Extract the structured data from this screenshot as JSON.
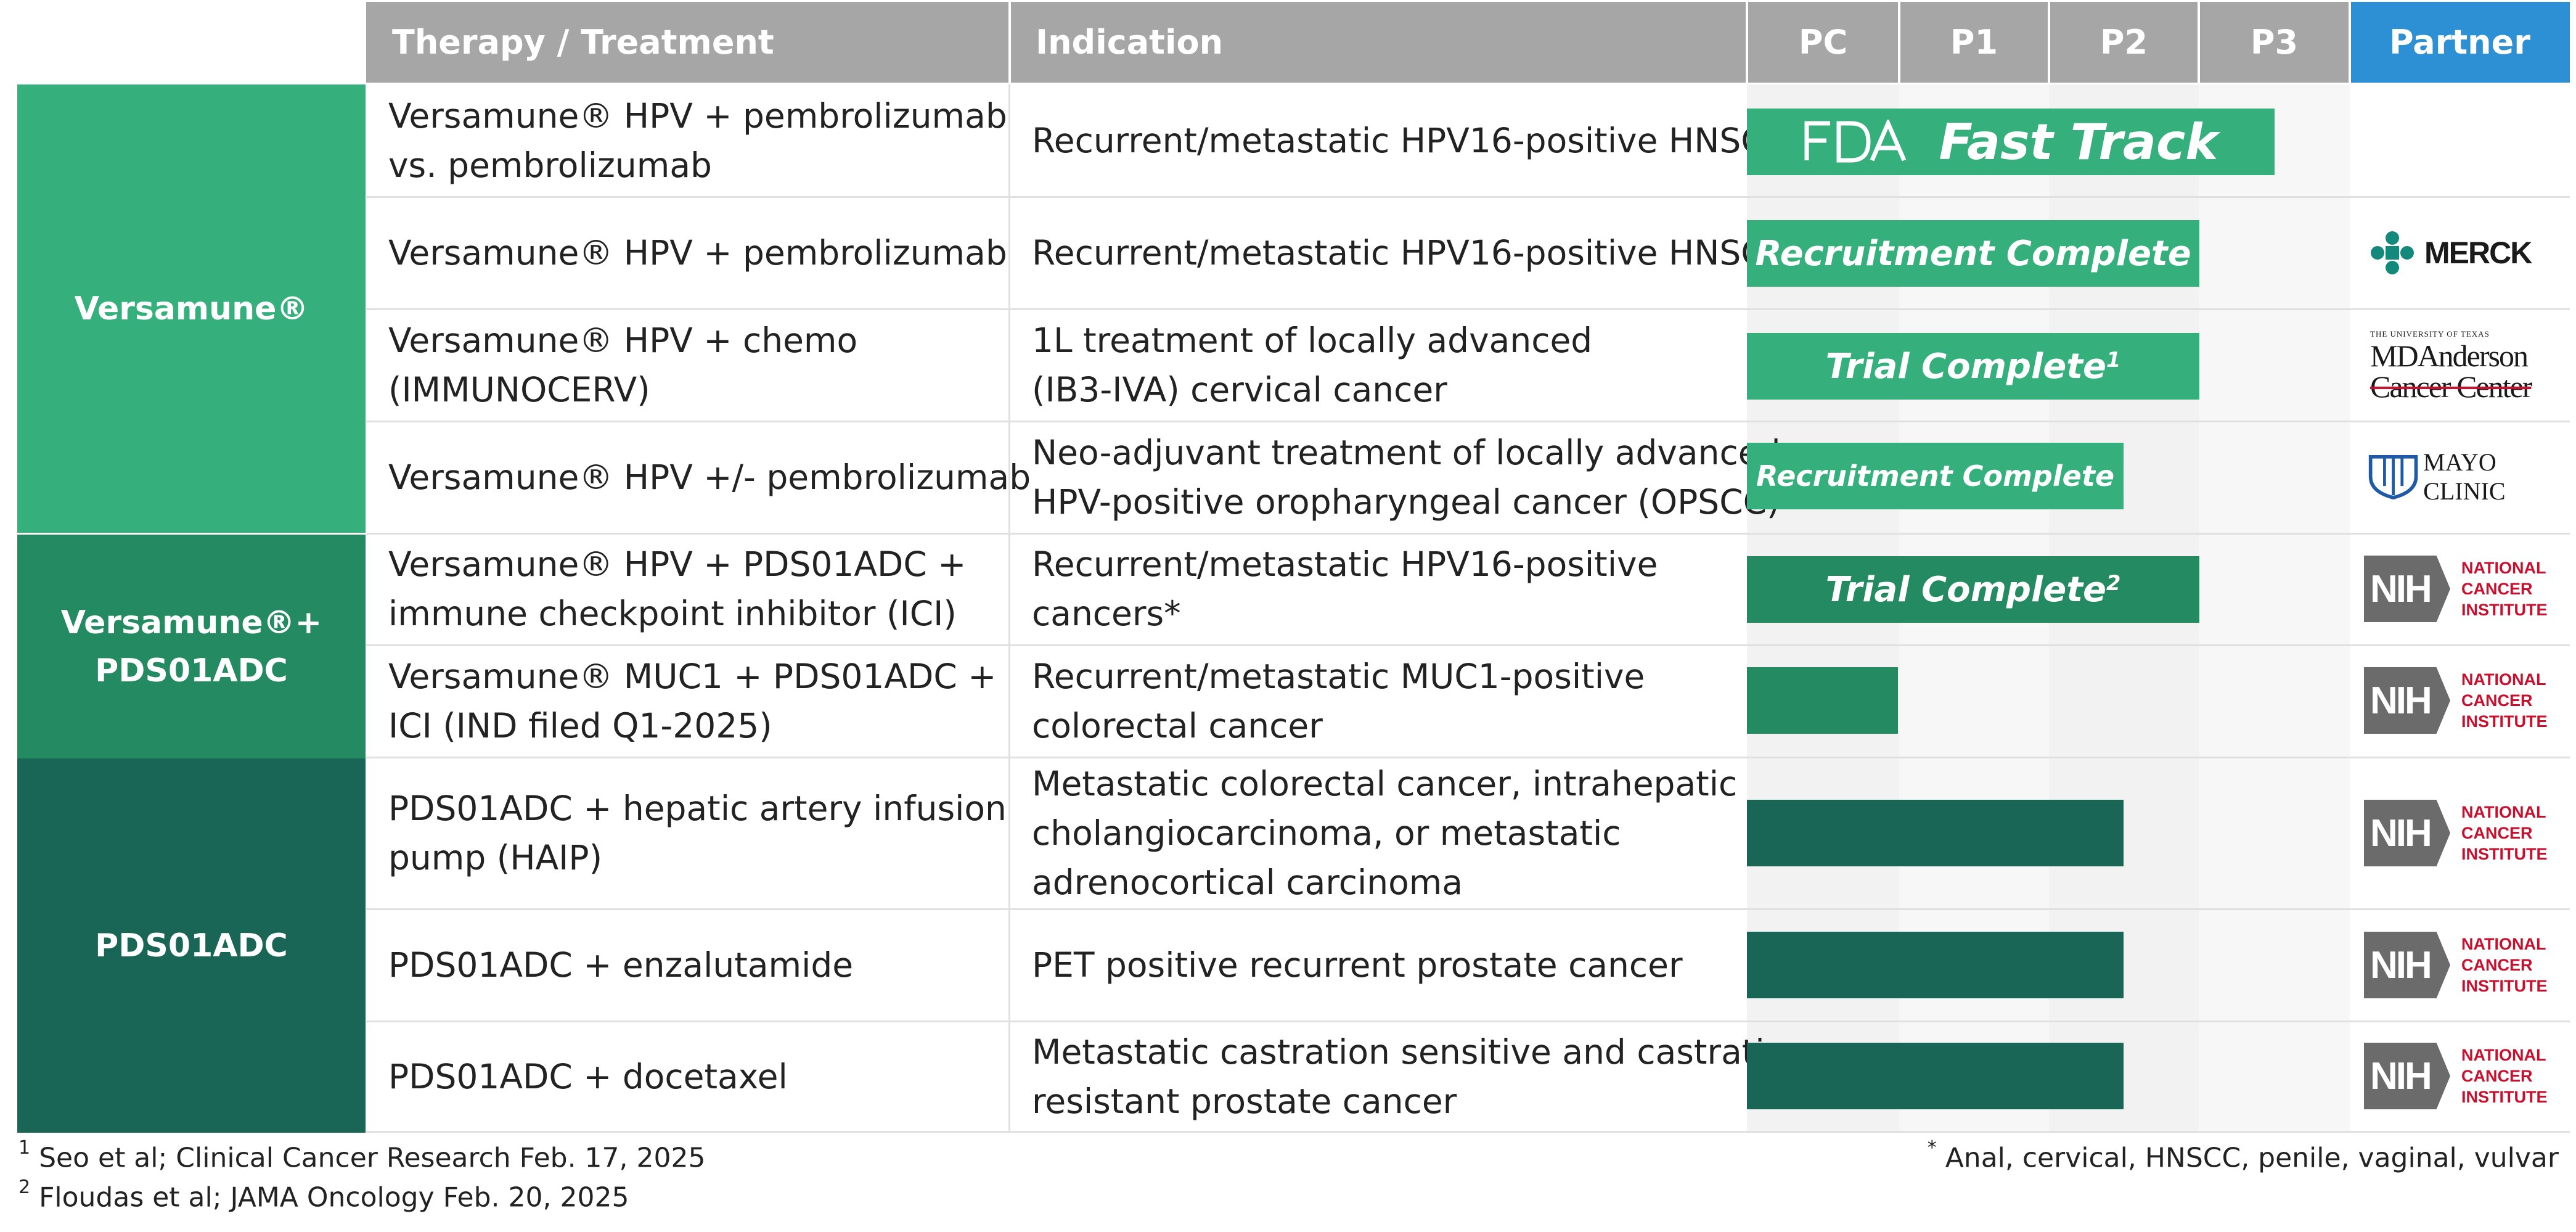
{
  "header": {
    "therapy": "Therapy / Treatment",
    "indication": "Indication",
    "phases": [
      "PC",
      "P1",
      "P2",
      "P3"
    ],
    "partner": "Partner"
  },
  "groups": [
    {
      "lines": [
        "Versamune®"
      ],
      "color": "#35b07d"
    },
    {
      "lines": [
        "Versamune®+",
        "PDS01ADC"
      ],
      "color": "#248a61"
    },
    {
      "lines": [
        "PDS01ADC"
      ],
      "color": "#1a6656"
    }
  ],
  "rows": [
    {
      "therapy": [
        "Versamune® HPV + pembrolizumab",
        "vs. pembrolizumab"
      ],
      "indication": [
        "Recurrent/metastatic HPV16-positive HNSCC"
      ],
      "bar_label": "Fast Track",
      "bar_fda": true,
      "bar_color": "#35b07d",
      "bar_note": "",
      "partner": null
    },
    {
      "therapy": [
        "Versamune® HPV + pembrolizumab"
      ],
      "indication": [
        "Recurrent/metastatic HPV16-positive HNSCC"
      ],
      "bar_label": "Recruitment Complete",
      "bar_color": "#35b07d",
      "bar_note": "",
      "partner": "MERCK"
    },
    {
      "therapy": [
        "Versamune® HPV + chemo",
        "(IMMUNOCERV)"
      ],
      "indication": [
        "1L treatment of locally advanced",
        "(IB3-IVA) cervical cancer"
      ],
      "bar_label": "Trial Complete",
      "bar_color": "#35b07d",
      "bar_note": "1",
      "partner": "MD Anderson"
    },
    {
      "therapy": [
        "Versamune® HPV +/- pembrolizumab"
      ],
      "indication": [
        "Neo-adjuvant treatment of locally advanced",
        "HPV-positive oropharyngeal cancer (OPSCC)"
      ],
      "bar_label": "Recruitment Complete",
      "bar_color": "#35b07d",
      "bar_note": "",
      "partner": "Mayo Clinic"
    },
    {
      "therapy": [
        "Versamune® HPV  +  PDS01ADC +",
        "immune checkpoint inhibitor (ICI)"
      ],
      "indication": [
        "Recurrent/metastatic HPV16-positive",
        "cancers*"
      ],
      "bar_label": "Trial Complete",
      "bar_color": "#248a61",
      "bar_note": "2",
      "partner": "NIH"
    },
    {
      "therapy": [
        "Versamune® MUC1 + PDS01ADC +",
        "ICI (IND filed Q1-2025)"
      ],
      "indication": [
        "Recurrent/metastatic MUC1-positive",
        "colorectal cancer"
      ],
      "bar_label": "",
      "bar_color": "#248a61",
      "bar_note": "",
      "partner": "NIH"
    },
    {
      "therapy": [
        "PDS01ADC + hepatic artery infusion",
        "pump (HAIP)"
      ],
      "indication": [
        "Metastatic colorectal cancer, intrahepatic",
        "cholangiocarcinoma, or metastatic",
        "adrenocortical carcinoma"
      ],
      "bar_label": "",
      "bar_color": "#1a6656",
      "bar_note": "",
      "partner": "NIH"
    },
    {
      "therapy": [
        "PDS01ADC + enzalutamide"
      ],
      "indication": [
        "PET positive recurrent prostate cancer"
      ],
      "bar_label": "",
      "bar_color": "#1a6656",
      "bar_note": "",
      "partner": "NIH"
    },
    {
      "therapy": [
        "PDS01ADC + docetaxel"
      ],
      "indication": [
        "Metastatic castration sensitive and castration",
        "resistant prostate cancer"
      ],
      "bar_label": "",
      "bar_color": "#1a6656",
      "bar_note": "",
      "partner": "NIH"
    }
  ],
  "chart_data": {
    "type": "bar",
    "categories": [
      "Versamune® HPV + pembrolizumab vs. pembrolizumab",
      "Versamune® HPV + pembrolizumab",
      "Versamune® HPV + chemo (IMMUNOCERV)",
      "Versamune® HPV +/- pembrolizumab",
      "Versamune® HPV + PDS01ADC + immune checkpoint inhibitor (ICI)",
      "Versamune® MUC1 + PDS01ADC + ICI (IND filed Q1-2025)",
      "PDS01ADC + hepatic artery infusion pump (HAIP)",
      "PDS01ADC + enzalutamide",
      "PDS01ADC + docetaxel"
    ],
    "values": [
      3.5,
      3.0,
      3.0,
      2.5,
      3.0,
      1.0,
      2.5,
      2.5,
      2.5
    ],
    "xlim": [
      0,
      4
    ],
    "axis_ticks": [
      "PC",
      "P1",
      "P2",
      "P3"
    ],
    "orientation": "horizontal"
  },
  "partners": {
    "merck": "MERCK",
    "mdanderson": {
      "top": "THE UNIVERSITY OF TEXAS",
      "line1": "MDAnderson",
      "line2": "Cancer Center"
    },
    "mayo": "MAYO CLINIC",
    "nih": {
      "box": "NIH",
      "lines": [
        "NATIONAL",
        "CANCER",
        "INSTITUTE"
      ]
    }
  },
  "footnotes": {
    "n1_mark": "1",
    "n1": "Seo et al; Clinical Cancer Research Feb. 17, 2025",
    "n2_mark": "2",
    "n2": "Floudas et al; JAMA Oncology Feb. 20, 2025",
    "star_mark": "*",
    "star": "Anal, cervical, HNSCC, penile, vaginal, vulvar"
  },
  "colors": {
    "header_grey": "#a6a6a6",
    "partner_blue": "#2d8fd4",
    "green_light": "#35b07d",
    "green_mid": "#248a61",
    "green_dark": "#1a6656",
    "nih_red": "#c8102e"
  }
}
